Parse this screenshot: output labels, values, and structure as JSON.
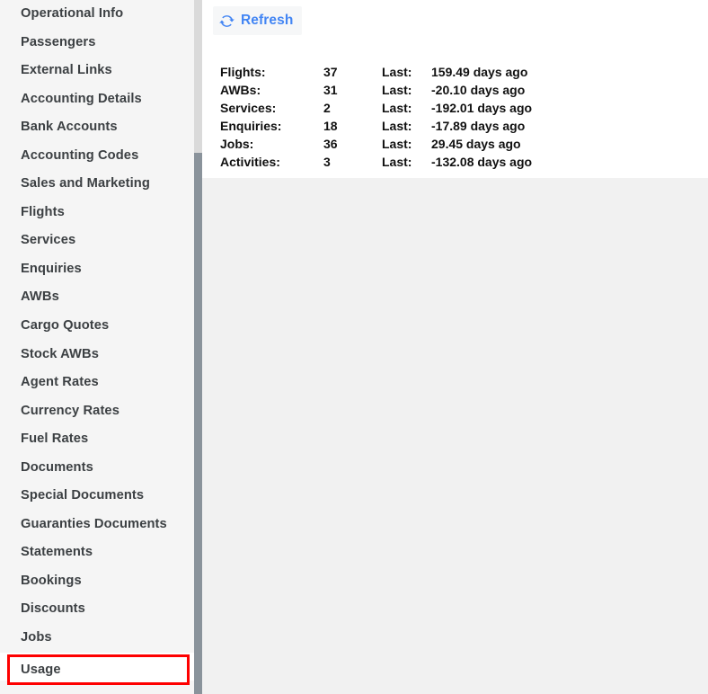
{
  "sidebar": {
    "items": [
      {
        "label": "Operational Info",
        "highlighted": false
      },
      {
        "label": "Passengers",
        "highlighted": false
      },
      {
        "label": "External Links",
        "highlighted": false
      },
      {
        "label": "Accounting Details",
        "highlighted": false
      },
      {
        "label": "Bank Accounts",
        "highlighted": false
      },
      {
        "label": "Accounting Codes",
        "highlighted": false
      },
      {
        "label": "Sales and Marketing",
        "highlighted": false
      },
      {
        "label": "Flights",
        "highlighted": false
      },
      {
        "label": "Services",
        "highlighted": false
      },
      {
        "label": "Enquiries",
        "highlighted": false
      },
      {
        "label": "AWBs",
        "highlighted": false
      },
      {
        "label": "Cargo Quotes",
        "highlighted": false
      },
      {
        "label": "Stock AWBs",
        "highlighted": false
      },
      {
        "label": "Agent Rates",
        "highlighted": false
      },
      {
        "label": "Currency Rates",
        "highlighted": false
      },
      {
        "label": "Fuel Rates",
        "highlighted": false
      },
      {
        "label": "Documents",
        "highlighted": false
      },
      {
        "label": "Special Documents",
        "highlighted": false
      },
      {
        "label": "Guaranties Documents",
        "highlighted": false
      },
      {
        "label": "Statements",
        "highlighted": false
      },
      {
        "label": "Bookings",
        "highlighted": false
      },
      {
        "label": "Discounts",
        "highlighted": false
      },
      {
        "label": "Jobs",
        "highlighted": false
      },
      {
        "label": "Usage",
        "highlighted": true
      }
    ],
    "highlight_color": "#fe0000",
    "background_color": "#f5f5f5",
    "text_color": "#3c4043",
    "scrollbar": {
      "track_color": "#dadada",
      "thumb_color": "#8a939b"
    }
  },
  "toolbar": {
    "refresh_label": "Refresh",
    "refresh_icon": "refresh-icon",
    "accent_color": "#4285f4"
  },
  "stats": {
    "last_label": "Last:",
    "rows": [
      {
        "name": "Flights:",
        "count": "37",
        "last_label": "Last:",
        "last_value": "159.49 days ago"
      },
      {
        "name": "AWBs:",
        "count": "31",
        "last_label": "Last:",
        "last_value": "-20.10 days ago"
      },
      {
        "name": "Services:",
        "count": "2",
        "last_label": "Last:",
        "last_value": "-192.01 days ago"
      },
      {
        "name": "Enquiries:",
        "count": "18",
        "last_label": "Last:",
        "last_value": "-17.89 days ago"
      },
      {
        "name": "Jobs:",
        "count": "36",
        "last_label": "Last:",
        "last_value": "29.45 days ago"
      },
      {
        "name": "Activities:",
        "count": "3",
        "last_label": "Last:",
        "last_value": "-132.08 days ago"
      }
    ]
  }
}
